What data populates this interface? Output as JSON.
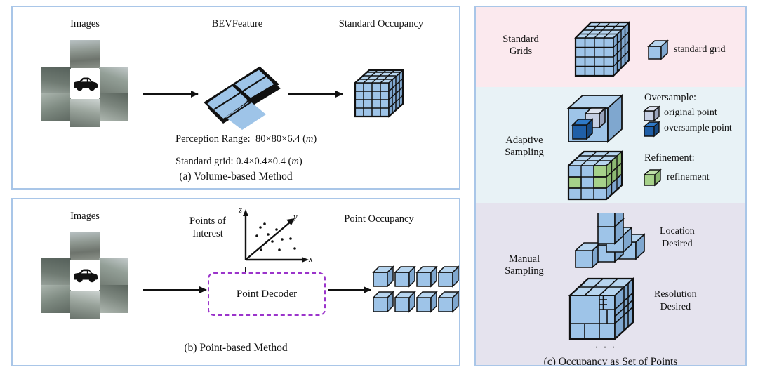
{
  "figure": {
    "panel_a": {
      "caption": "(a) Volume-based Method",
      "labels": {
        "images": "Images",
        "bev": "BEVFeature",
        "occupancy": "Standard Occupancy"
      },
      "notes": {
        "perception_range_label": "Perception Range:",
        "perception_range_value": "80×80×6.4 (",
        "perception_range_unit": "m",
        "standard_grid_label": "Standard grid:",
        "standard_grid_value": "0.4×0.4×0.4 (",
        "standard_grid_unit": "m"
      },
      "grid_cube": {
        "cols": 4,
        "rows": 4
      },
      "bev_tiles": 4
    },
    "panel_b": {
      "caption": "(b) Point-based Method",
      "labels": {
        "images": "Images",
        "points_of_interest": "Points of\nInterest",
        "point_occupancy": "Point Occupancy",
        "decoder": "Point Decoder"
      },
      "axes": {
        "x": "x",
        "y": "y",
        "z": "z"
      },
      "point_cubes": {
        "rows": 2,
        "cols": 4
      },
      "decoder_border_color": "#9b34cb"
    },
    "panel_c": {
      "caption": "(c) Occupancy as Set of Points",
      "sections": [
        {
          "name": "standard-grids",
          "label": "Standard\nGrids",
          "background": "#fbe9ee",
          "legend": [
            {
              "text": "standard grid",
              "color": "#9ec4e8"
            }
          ],
          "cube": {
            "cols": 4,
            "rows": 4
          }
        },
        {
          "name": "adaptive-sampling",
          "label": "Adaptive\nSampling",
          "background": "#e8f2f6",
          "legend_groups": [
            {
              "title": "Oversample:",
              "items": [
                {
                  "text": "original point",
                  "color": "#c5cfe3"
                },
                {
                  "text": "oversample point",
                  "color": "#1f5fa8"
                }
              ]
            },
            {
              "title": "Refinement:",
              "items": [
                {
                  "text": "refinement",
                  "color": "#a6d18a"
                }
              ]
            }
          ]
        },
        {
          "name": "manual-sampling",
          "label": "Manual\nSampling",
          "background": "#e5e3ee",
          "legend": [
            {
              "text": "Location\nDesired"
            },
            {
              "text": "Resolution\nDesired"
            }
          ],
          "ellipsis": "∙ ∙ ∙"
        }
      ]
    }
  },
  "colors": {
    "cube_face": "#9ec4e8",
    "cube_side": "#7fa7cf",
    "cube_top": "#b7d5ef",
    "panel_border": "#a9c6e8",
    "accent_purple": "#9b34cb",
    "refine_green": "#a6d18a"
  }
}
